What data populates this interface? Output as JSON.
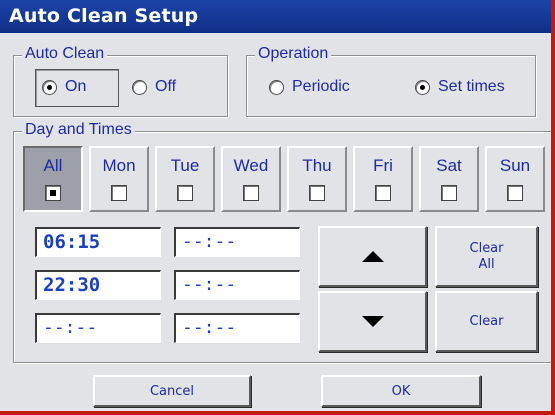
{
  "window": {
    "title": "Auto Clean Setup"
  },
  "auto_clean": {
    "legend": "Auto Clean",
    "options": [
      {
        "label": "On",
        "checked": true
      },
      {
        "label": "Off",
        "checked": false
      }
    ]
  },
  "operation": {
    "legend": "Operation",
    "options": [
      {
        "label": "Periodic",
        "checked": false
      },
      {
        "label": "Set times",
        "checked": true
      }
    ]
  },
  "days": {
    "legend": "Day and Times",
    "items": [
      {
        "label": "All",
        "checked": true,
        "active": true
      },
      {
        "label": "Mon",
        "checked": false
      },
      {
        "label": "Tue",
        "checked": false
      },
      {
        "label": "Wed",
        "checked": false
      },
      {
        "label": "Thu",
        "checked": false
      },
      {
        "label": "Fri",
        "checked": false
      },
      {
        "label": "Sat",
        "checked": false
      },
      {
        "label": "Sun",
        "checked": false
      }
    ]
  },
  "times": {
    "col1": [
      "06:15",
      "22:30",
      "--:--"
    ],
    "col2": [
      "--:--",
      "--:--",
      "--:--"
    ]
  },
  "buttons": {
    "up_icon": "arrow-up-icon",
    "down_icon": "arrow-down-icon",
    "clear_all_line1": "Clear",
    "clear_all_line2": "All",
    "clear": "Clear",
    "cancel": "Cancel",
    "ok": "OK"
  },
  "colors": {
    "title_bar": "#0f2f86",
    "frame": "#c21a10",
    "text": "#1d2aa0",
    "time_text": "#1a3fc4"
  }
}
